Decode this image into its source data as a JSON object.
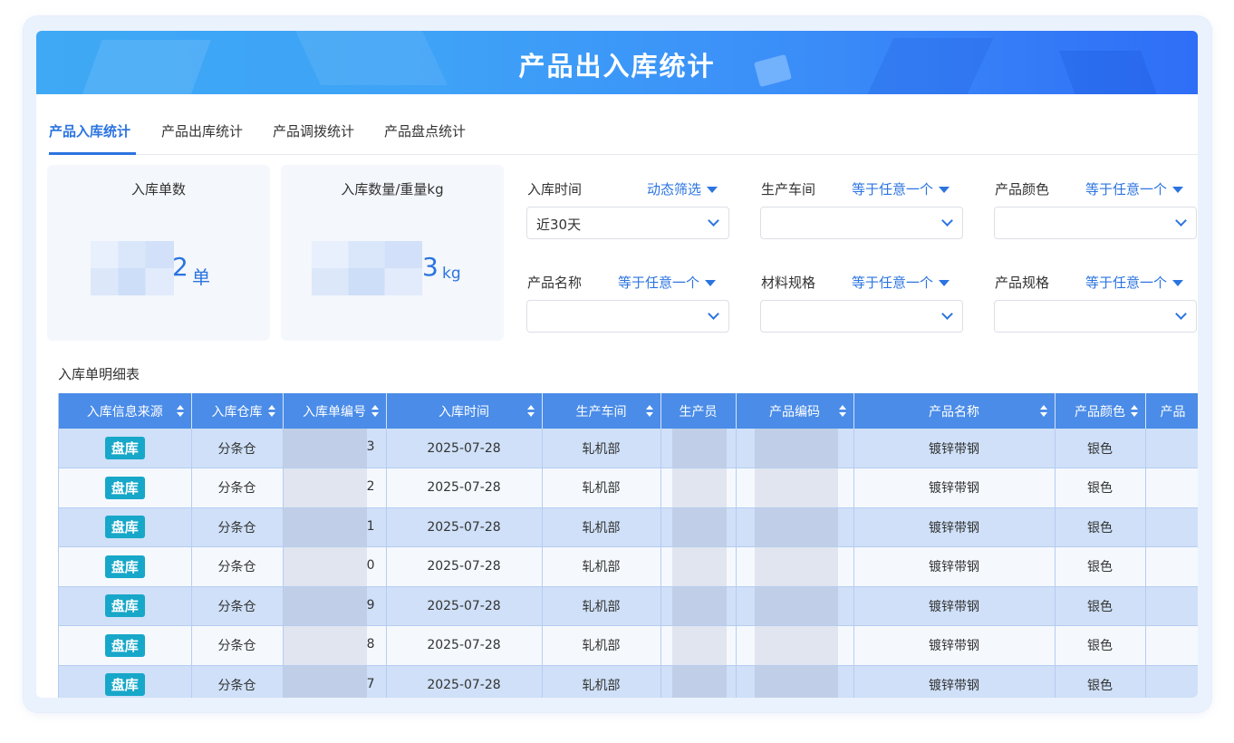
{
  "header": {
    "title": "产品出入库统计"
  },
  "tabs": [
    {
      "label": "产品入库统计",
      "active": true
    },
    {
      "label": "产品出库统计"
    },
    {
      "label": "产品调拨统计"
    },
    {
      "label": "产品盘点统计"
    }
  ],
  "stats": [
    {
      "label": "入库单数",
      "value": "2",
      "unit": "单"
    },
    {
      "label": "入库数量/重量kg",
      "value": "3",
      "unit": "kg"
    }
  ],
  "filters": [
    {
      "label": "入库时间",
      "op": "动态筛选",
      "value": "近30天"
    },
    {
      "label": "生产车间",
      "op": "等于任意一个",
      "value": ""
    },
    {
      "label": "产品颜色",
      "op": "等于任意一个",
      "value": ""
    },
    {
      "label": "产品名称",
      "op": "等于任意一个",
      "value": ""
    },
    {
      "label": "材料规格",
      "op": "等于任意一个",
      "value": ""
    },
    {
      "label": "产品规格",
      "op": "等于任意一个",
      "value": ""
    }
  ],
  "table": {
    "title": "入库单明细表",
    "columns": [
      "入库信息来源",
      "入库仓库",
      "入库单编号",
      "入库时间",
      "生产车间",
      "生产员",
      "产品编码",
      "产品名称",
      "产品颜色",
      "产品"
    ],
    "rows": [
      {
        "source": "盘库",
        "warehouse": "分条仓",
        "no_tail": "3",
        "time": "2025-07-28",
        "workshop": "轧机部",
        "name": "镀锌带钢",
        "color": "银色"
      },
      {
        "source": "盘库",
        "warehouse": "分条仓",
        "no_tail": "2",
        "time": "2025-07-28",
        "workshop": "轧机部",
        "name": "镀锌带钢",
        "color": "银色"
      },
      {
        "source": "盘库",
        "warehouse": "分条仓",
        "no_tail": "1",
        "time": "2025-07-28",
        "workshop": "轧机部",
        "name": "镀锌带钢",
        "color": "银色"
      },
      {
        "source": "盘库",
        "warehouse": "分条仓",
        "no_tail": "0",
        "time": "2025-07-28",
        "workshop": "轧机部",
        "name": "镀锌带钢",
        "color": "银色"
      },
      {
        "source": "盘库",
        "warehouse": "分条仓",
        "no_tail": "9",
        "time": "2025-07-28",
        "workshop": "轧机部",
        "name": "镀锌带钢",
        "color": "银色"
      },
      {
        "source": "盘库",
        "warehouse": "分条仓",
        "no_tail": "8",
        "time": "2025-07-28",
        "workshop": "轧机部",
        "name": "镀锌带钢",
        "color": "银色"
      },
      {
        "source": "盘库",
        "warehouse": "分条仓",
        "no_tail": "7",
        "time": "2025-07-28",
        "workshop": "轧机部",
        "name": "镀锌带钢",
        "color": "银色"
      }
    ]
  }
}
